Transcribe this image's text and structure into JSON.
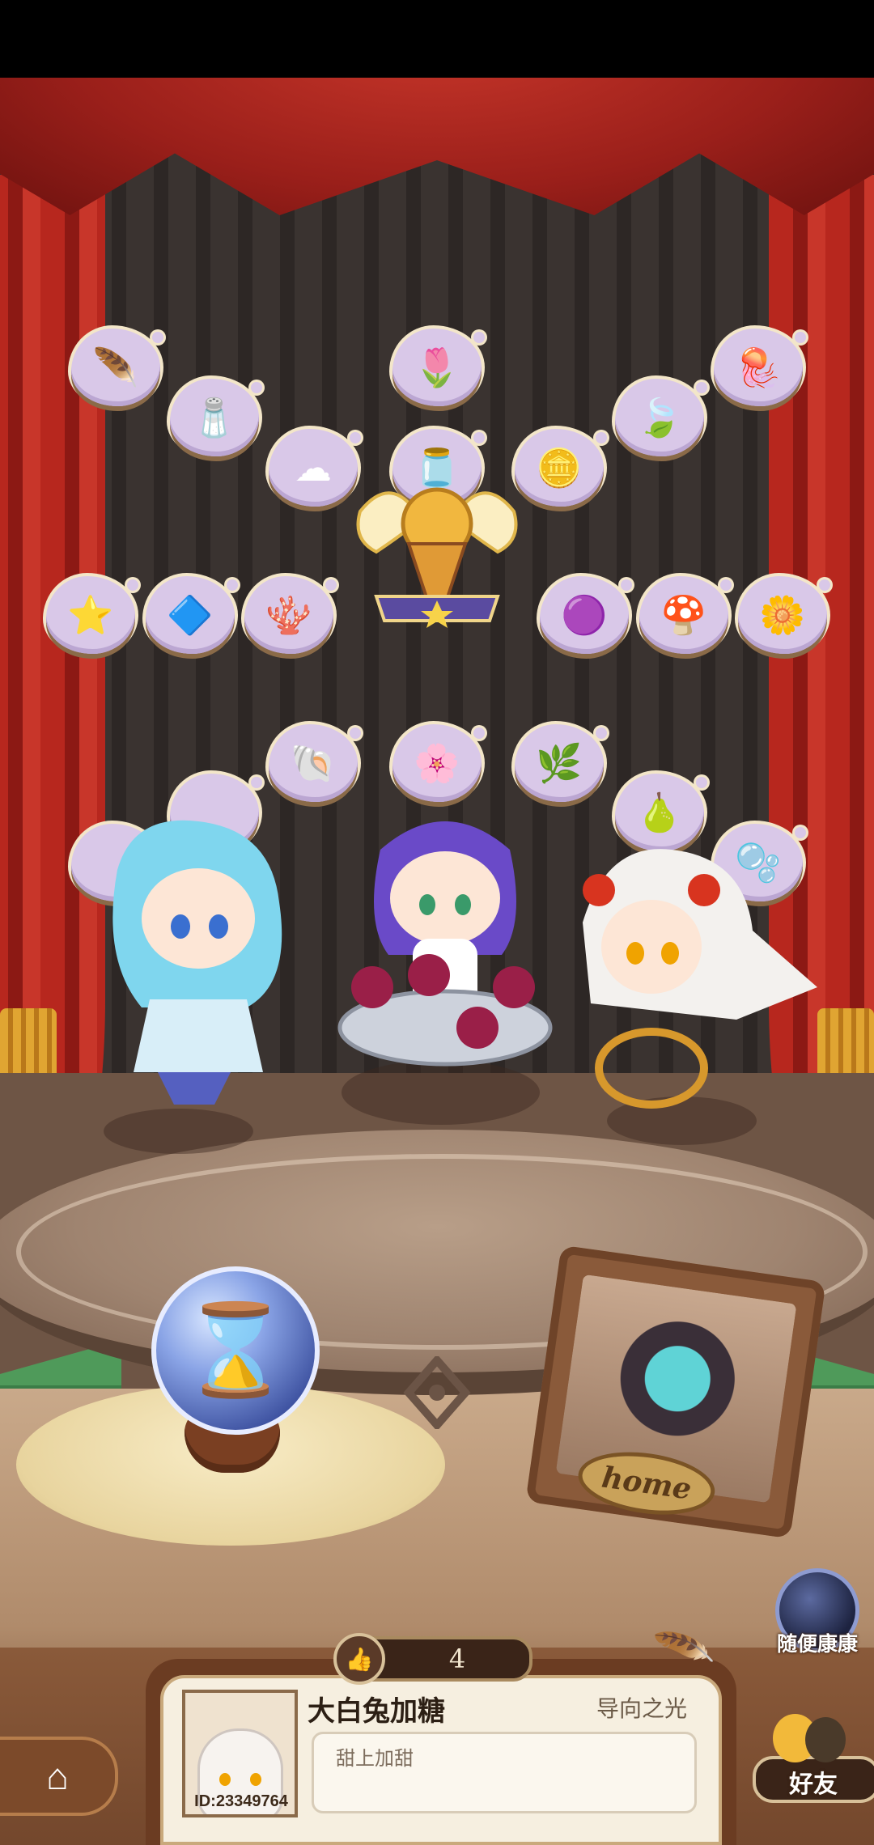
{
  "items": [
    {
      "name": "rainbow-feather-icon",
      "glyph": "🪶",
      "color": "#8fd3ff"
    },
    {
      "name": "flower-bud-icon",
      "glyph": "🌷",
      "color": "#f6e57a"
    },
    {
      "name": "jellyfish-icon",
      "glyph": "🪼",
      "color": "#3aa0e6"
    },
    {
      "name": "salt-pile-icon",
      "glyph": "🧂",
      "color": "#8ec9ee"
    },
    {
      "name": "leaf-icon",
      "glyph": "🍃",
      "color": "#6fd38a"
    },
    {
      "name": "cotton-cloud-icon",
      "glyph": "☁",
      "color": "#ffffff"
    },
    {
      "name": "potion-jar-icon",
      "glyph": "🫙",
      "color": "#f07a9a"
    },
    {
      "name": "gold-nugget-icon",
      "glyph": "🪙",
      "color": "#f3c14a"
    },
    {
      "name": "star-icon",
      "glyph": "⭐",
      "color": "#f7c833"
    },
    {
      "name": "crystal-icon",
      "glyph": "🔷",
      "color": "#2f8de0"
    },
    {
      "name": "coral-icon",
      "glyph": "🪸",
      "color": "#f07aa5"
    },
    {
      "name": "purple-rock-icon",
      "glyph": "🟣",
      "color": "#9a5ad6"
    },
    {
      "name": "mushroom-icon",
      "glyph": "🍄",
      "color": "#8fd8f0"
    },
    {
      "name": "blue-flower-icon",
      "glyph": "🌼",
      "color": "#5f8ee6"
    },
    {
      "name": "shell-icon",
      "glyph": "🐚",
      "color": "#ff9aa8"
    },
    {
      "name": "white-flower-icon",
      "glyph": "🌸",
      "color": "#f6e57a"
    },
    {
      "name": "herb-icon",
      "glyph": "🌿",
      "color": "#6ec05a"
    },
    {
      "name": "teal-pear-icon",
      "glyph": "🍐",
      "color": "#2fb3a0"
    },
    {
      "name": "blue-jelly-icon",
      "glyph": "🫧",
      "color": "#7fb2f0"
    },
    {
      "name": "hidden-item-left-icon",
      "glyph": "",
      "color": "#d9c8e8"
    },
    {
      "name": "hidden-item-left2-icon",
      "glyph": "",
      "color": "#d9c8e8"
    }
  ],
  "like_count": "4",
  "player": {
    "name": "大白兔加糖",
    "title": "导向之光",
    "message": "甜上加甜",
    "id": "ID:23349764"
  },
  "buttons": {
    "random_label": "随便康康",
    "friends_label": "好友",
    "home_sign": "home"
  },
  "colors": {
    "curtain": "#b7271e",
    "gold": "#e0a532",
    "cloud": "#d9c8e8",
    "frame": "#8a5a3a"
  }
}
